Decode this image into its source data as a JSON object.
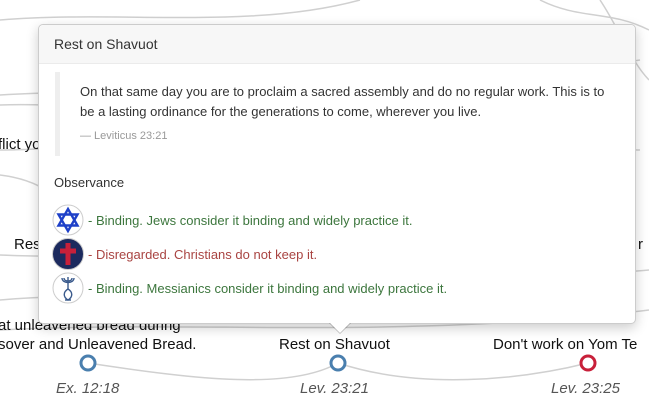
{
  "background": {
    "fragments": {
      "left_mid": "flict yo",
      "left_res": "Res",
      "right_r": "r",
      "bottom_left_line1": "at unleavened bread during",
      "bottom_left_line2": "sover and Unleavened Bread."
    },
    "nodes": [
      {
        "label": "",
        "ref": "Ex. 12:18",
        "color": "#4a7fae"
      },
      {
        "label": "Rest on Shavuot",
        "ref": "Lev. 23:21",
        "color": "#4a7fae"
      },
      {
        "label": "Don't work on Yom Te",
        "ref": "Lev. 23:25",
        "color": "#c8203a"
      }
    ]
  },
  "popover": {
    "title": "Rest on Shavuot",
    "quote": "On that same day you are to proclaim a sacred assembly and do no regular work. This is to be a lasting ordinance for the generations to come, wherever you live.",
    "citation": "— Leviticus 23:21",
    "observance_heading": "Observance",
    "observances": [
      {
        "icon": "star-of-david-icon",
        "text": "- Binding. Jews consider it binding and widely practice it.",
        "status": "binding"
      },
      {
        "icon": "cross-icon",
        "text": "- Disregarded. Christians do not keep it.",
        "status": "disregarded"
      },
      {
        "icon": "menorah-fish-icon",
        "text": "- Binding. Messianics consider it binding and widely practice it.",
        "status": "binding"
      }
    ]
  },
  "colors": {
    "binding": "#3c763d",
    "disregarded": "#a94442",
    "node_blue": "#4a7fae",
    "node_red": "#c8203a"
  }
}
